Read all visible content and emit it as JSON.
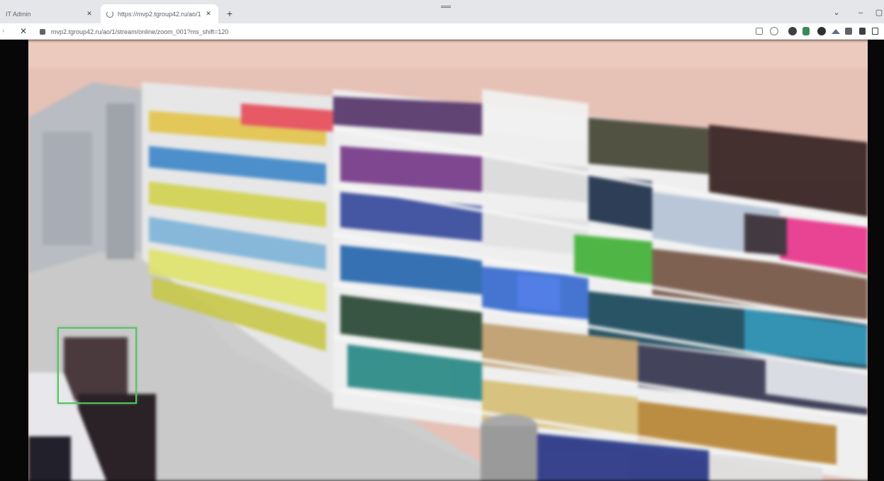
{
  "browser": {
    "tabs": [
      {
        "label": "IT Admin",
        "active": false
      },
      {
        "label": "https://mvp2.tgroup42.ru/ao/1",
        "active": true,
        "loading": true
      }
    ],
    "new_tab_label": "+",
    "address_bar": {
      "url": "mvp2.tgroup42.ru/ao/1/stream/online/zoom_001?ms_shift=120"
    },
    "toolbar_icons": [
      "share-icon",
      "zoom-icon",
      "extension-icon",
      "extension-icon",
      "extension-icon",
      "extension-icon",
      "puzzle-icon",
      "profile-icon",
      "sidebar-icon"
    ]
  },
  "video": {
    "detection_color": "#55c35f",
    "scene_colors": {
      "wall": "#e8c2b6",
      "floor": "#cfcfcf",
      "shelf": "#f3f3f3"
    }
  }
}
